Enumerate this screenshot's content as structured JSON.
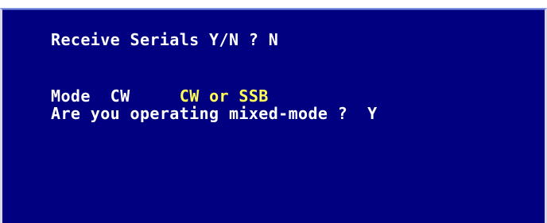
{
  "receive_serials": {
    "prompt": "Receive Serials Y/N ? ",
    "answer": "N"
  },
  "mode": {
    "label": "Mode  ",
    "value": "CW",
    "gap": "     ",
    "hint": "CW or SSB"
  },
  "mixed_mode": {
    "prompt": "Are you operating mixed-mode ?  ",
    "answer": "Y"
  },
  "colors": {
    "background": "#000080",
    "text": "#ffffff",
    "hint": "#ffff55"
  }
}
